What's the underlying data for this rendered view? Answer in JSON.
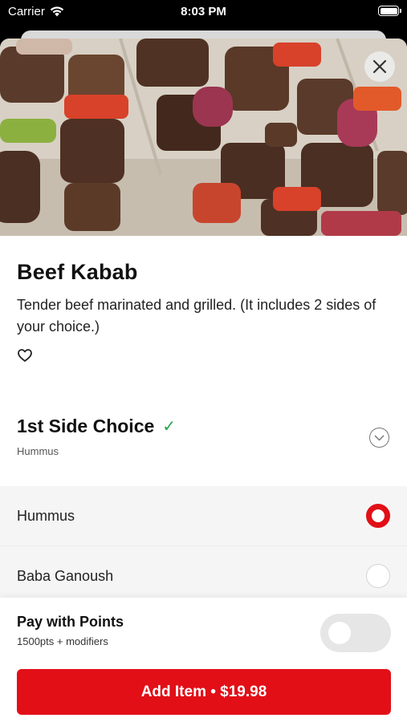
{
  "status_bar": {
    "carrier": "Carrier",
    "time": "8:03 PM"
  },
  "item": {
    "image_icon": "kabab-photo",
    "title": "Beef Kabab",
    "description": "Tender beef marinated and grilled. (It includes 2 sides of your choice.)",
    "favorite_icon": "heart-outline-icon"
  },
  "side_choice": {
    "title": "1st Side Choice",
    "check": "✓",
    "selected_summary": "Hummus",
    "options": [
      {
        "label": "Hummus",
        "selected": true
      },
      {
        "label": "Baba Ganoush",
        "selected": false
      }
    ]
  },
  "points": {
    "title": "Pay with Points",
    "subtitle": "1500pts + modifiers",
    "enabled": false
  },
  "add_button": {
    "label": "Add Item • $19.98"
  },
  "colors": {
    "accent": "#e20f17",
    "check": "#22a54a"
  }
}
